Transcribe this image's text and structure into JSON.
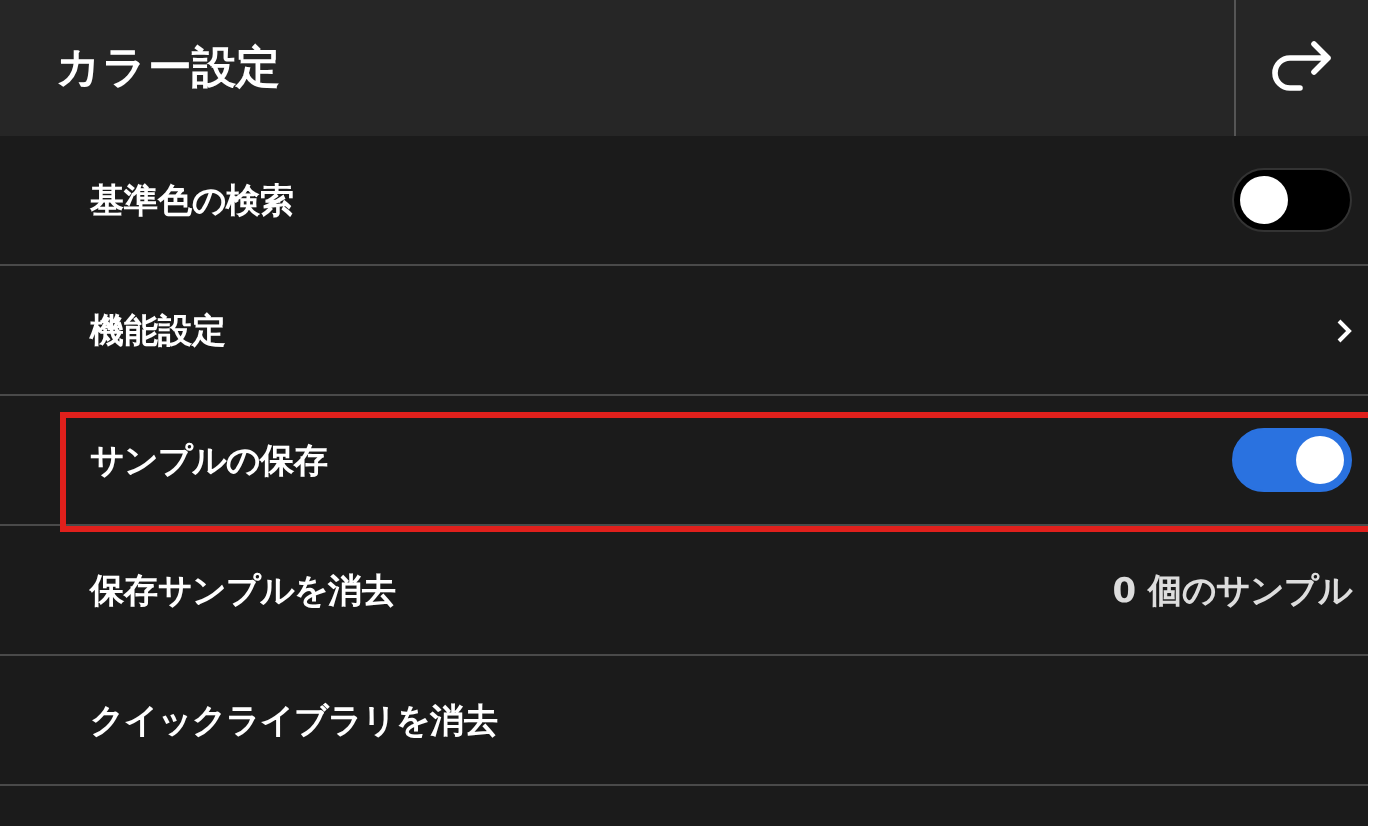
{
  "header": {
    "title": "カラー設定"
  },
  "rows": [
    {
      "kind": "toggle",
      "label": "基準色の検索",
      "on": false,
      "highlighted": false
    },
    {
      "kind": "link",
      "label": "機能設定",
      "highlighted": false
    },
    {
      "kind": "toggle",
      "label": "サンプルの保存",
      "on": true,
      "highlighted": true
    },
    {
      "kind": "value",
      "label": "保存サンプルを消去",
      "value": "0 個のサンプル",
      "highlighted": false
    },
    {
      "kind": "plain",
      "label": "クイックライブラリを消去",
      "highlighted": false
    }
  ]
}
